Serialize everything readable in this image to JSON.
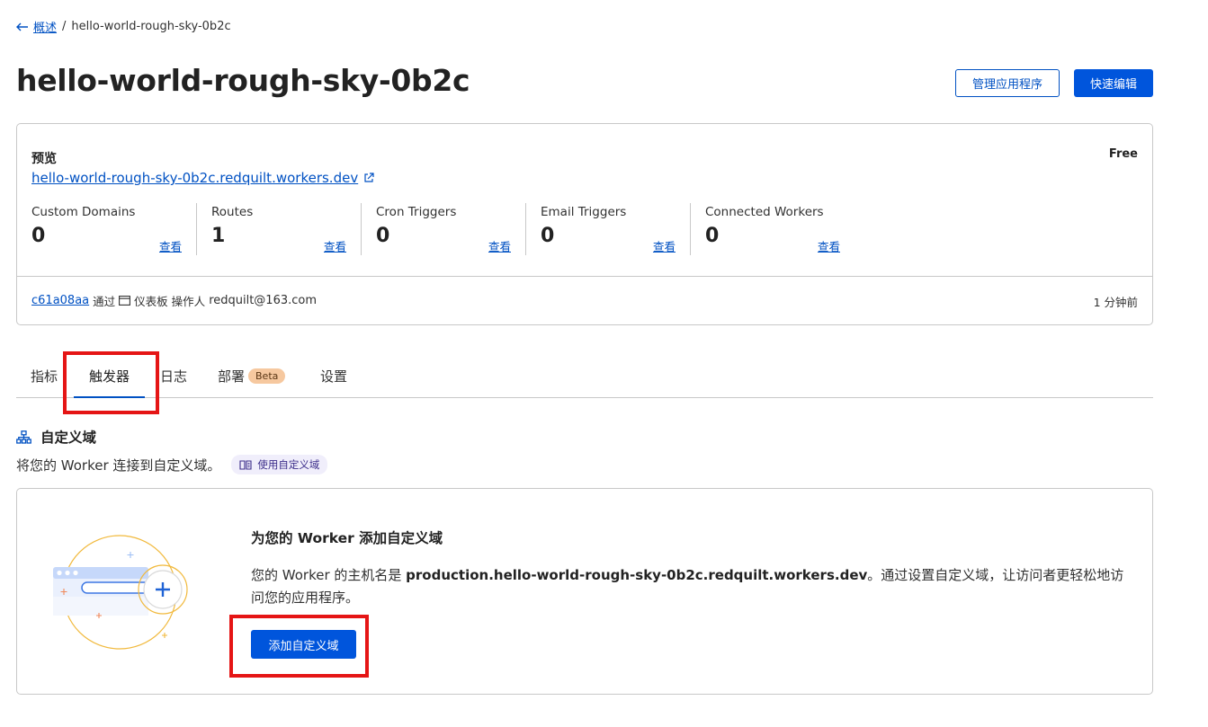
{
  "breadcrumb": {
    "back_label": "概述",
    "separator": "/",
    "current": "hello-world-rough-sky-0b2c"
  },
  "page": {
    "title": "hello-world-rough-sky-0b2c"
  },
  "header_actions": {
    "manage_label": "管理应用程序",
    "quick_edit_label": "快速编辑"
  },
  "overview": {
    "preview_label": "预览",
    "preview_url": "hello-world-rough-sky-0b2c.redquilt.workers.dev",
    "plan": "Free",
    "stats": [
      {
        "label": "Custom Domains",
        "value": "0",
        "link": "查看"
      },
      {
        "label": "Routes",
        "value": "1",
        "link": "查看"
      },
      {
        "label": "Cron Triggers",
        "value": "0",
        "link": "查看"
      },
      {
        "label": "Email Triggers",
        "value": "0",
        "link": "查看"
      },
      {
        "label": "Connected Workers",
        "value": "0",
        "link": "查看"
      }
    ],
    "deploy": {
      "commit": "c61a08aa",
      "via": "通过",
      "source": "仪表板",
      "operator_label": "操作人",
      "operator": "redquilt@163.com",
      "time": "1 分钟前"
    }
  },
  "tabs": [
    {
      "label": "指标"
    },
    {
      "label": "触发器",
      "active": true
    },
    {
      "label": "日志"
    },
    {
      "label": "部署",
      "badge": "Beta"
    },
    {
      "label": "设置"
    }
  ],
  "custom_domains": {
    "title": "自定义域",
    "description": "将您的 Worker 连接到自定义域。",
    "doc_link": "使用自定义域",
    "empty_heading": "为您的 Worker 添加自定义域",
    "empty_body_prefix": "您的 Worker 的主机名是",
    "hostname": "production.hello-world-rough-sky-0b2c.redquilt.workers.dev",
    "empty_body_suffix": "。通过设置自定义域，让访问者更轻松地访问您的应用程序。",
    "add_button": "添加自定义域"
  },
  "colors": {
    "accent": "#0055dc",
    "link": "#0051c3",
    "highlight": "#e51515",
    "beta_badge": "#f6c89f"
  }
}
